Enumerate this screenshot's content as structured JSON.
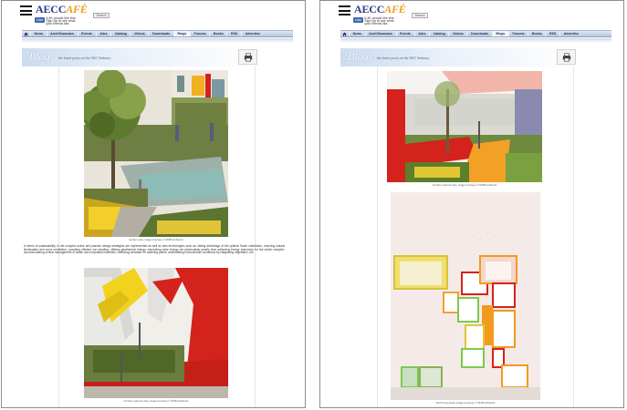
{
  "site": {
    "logo_main": "AECC",
    "logo_accent": "AFÉ",
    "search_label": "Search",
    "fb_button": "Like",
    "fb_text": "6.4K people like this. Sign Up to see what your friends like."
  },
  "nav": {
    "items": [
      {
        "label": "News",
        "active": false
      },
      {
        "label": "ArchShowcase",
        "active": false
      },
      {
        "label": "Events",
        "active": false
      },
      {
        "label": "Jobs",
        "active": false
      },
      {
        "label": "Catalog",
        "active": false
      },
      {
        "label": "Videos",
        "active": false
      },
      {
        "label": "Downloads",
        "active": false
      },
      {
        "label": "Blogs",
        "active": true
      },
      {
        "label": "Forums",
        "active": false
      },
      {
        "label": "Books",
        "active": false
      },
      {
        "label": "RSS",
        "active": false
      },
      {
        "label": "Advertise",
        "active": false
      }
    ]
  },
  "banner": {
    "title": "Blogs",
    "subtitle": "the latest posts on the AEC Industry"
  },
  "left_page": {
    "caption_1": "Garden view, Image Courtesy © MOB architects",
    "paragraph": "In terms of sustainability, in the complex active and passive design strategies are implemented as well as new technologies such as: taking advantage of the optimal South orientation, ensuring natural illumination and cross ventilation; providing efficient sun shading; utilizing geothermal energy; harvesting solar energy via photovoltaic panels thus achieving energy autonomy for the whole complex; accommodating central management of waste and recyclable materials; collecting rainwater for watering plants; ameliorating microclimatic conditions by integrating vegetation, etc.",
    "caption_2": "Corridor network view, Image Courtesy © MOB architects"
  },
  "right_page": {
    "caption_1": "Corridor network view, Image Courtesy © MOB architects",
    "caption_2": "North view detail, Image Courtesy © MOB architects"
  },
  "colors": {
    "brand_blue": "#2b3d84",
    "brand_orange": "#f29a1e",
    "nav_text": "#1d2f5a",
    "accent_red": "#d4221c"
  }
}
